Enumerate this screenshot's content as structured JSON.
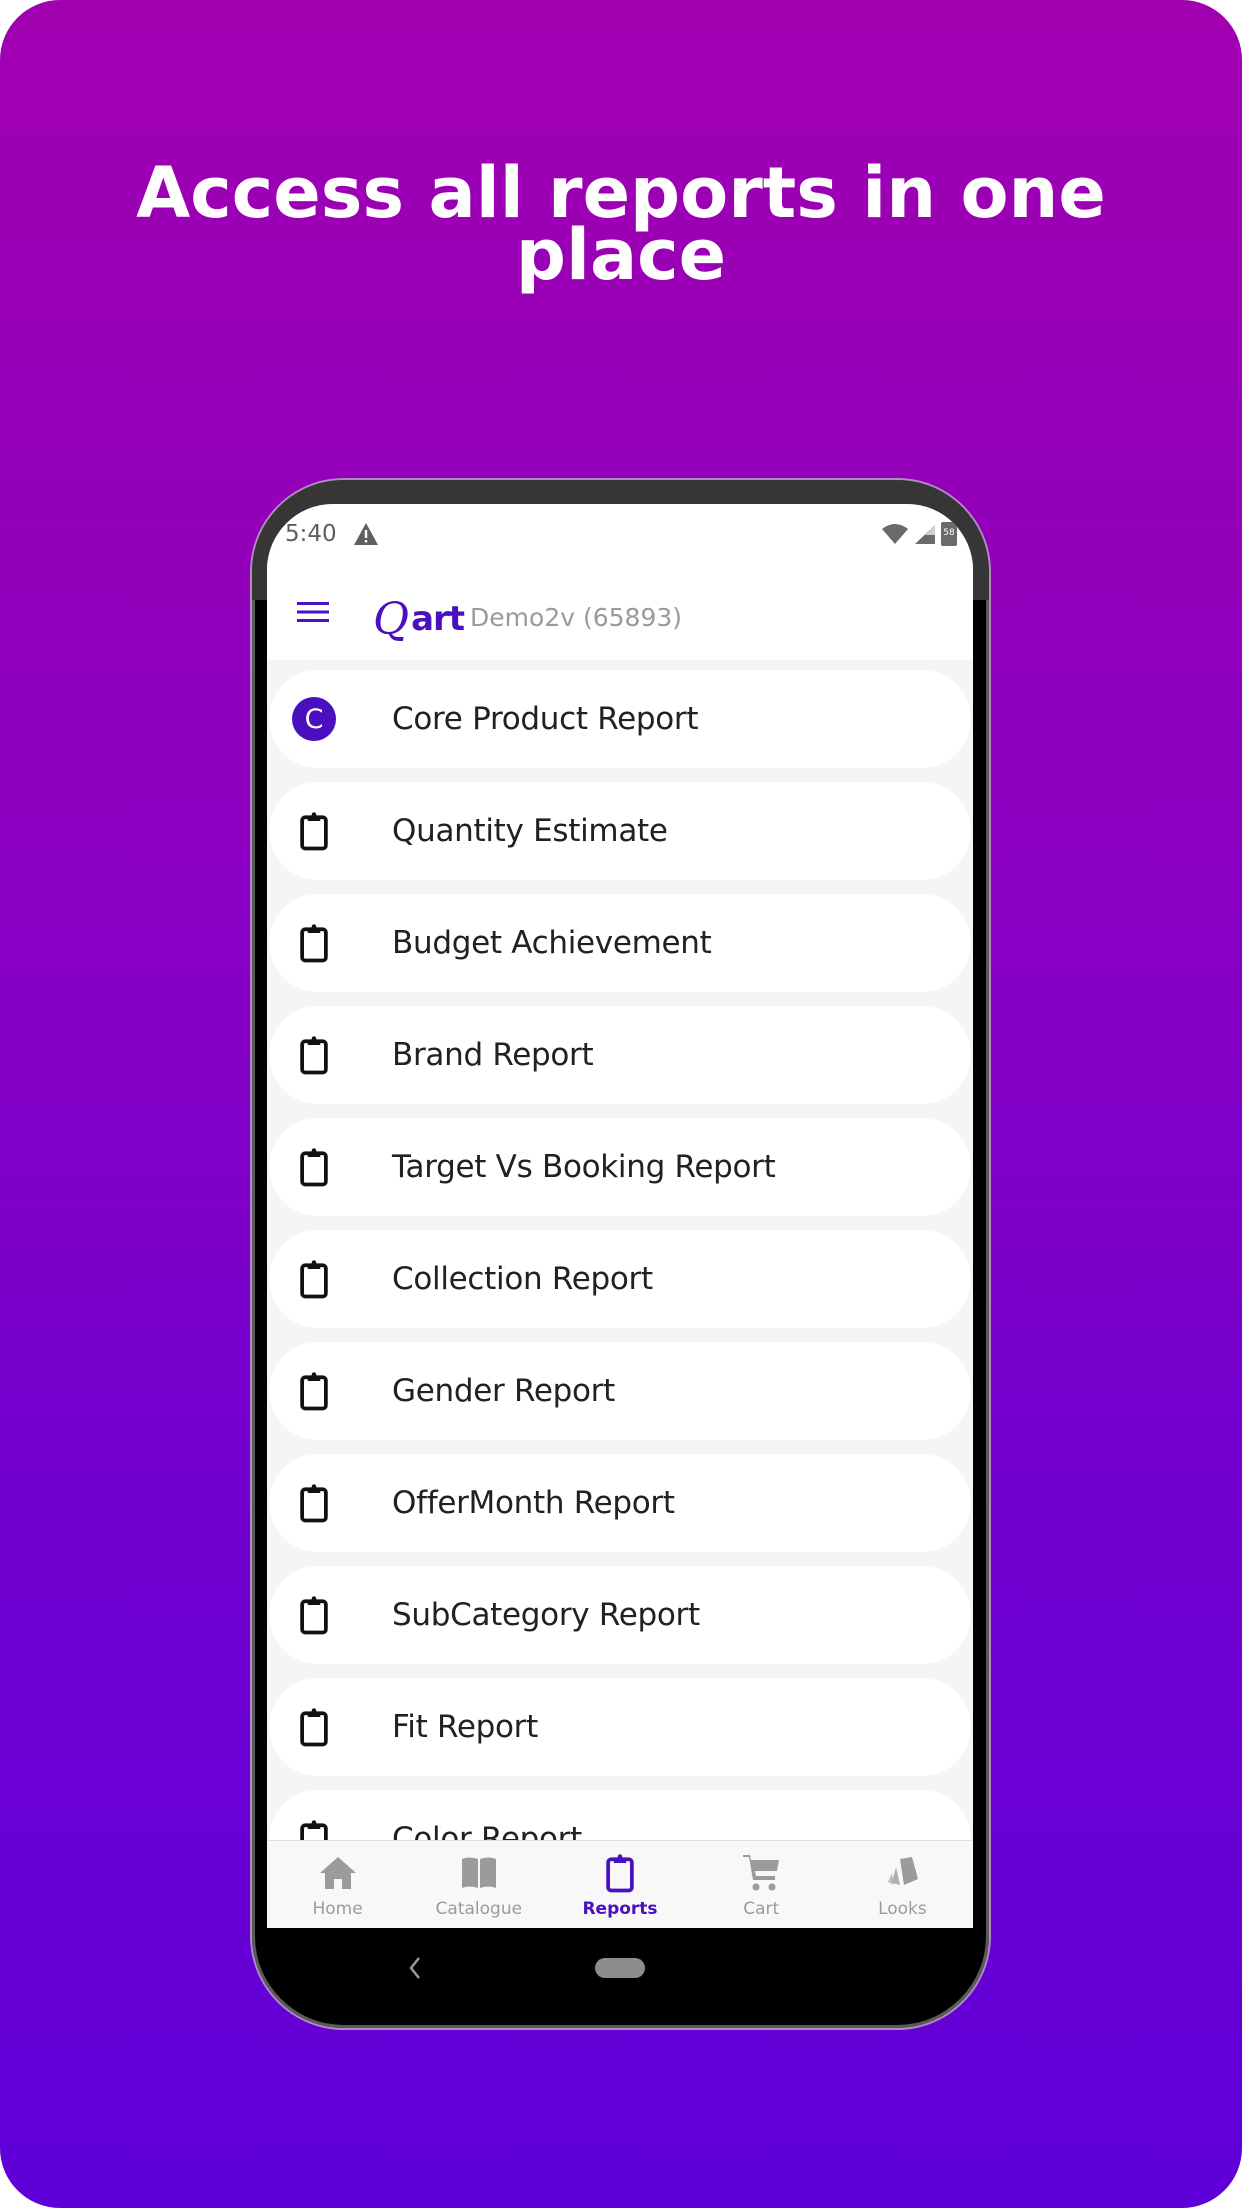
{
  "headline": {
    "line1": "Access all reports in one",
    "line2": "place"
  },
  "colors": {
    "gradient_top": "#a100b0",
    "gradient_bottom": "#5f00d9",
    "accent": "#4a10c0",
    "inactive": "#9b9b9b"
  },
  "statusbar": {
    "time": "5:40",
    "battery": "58",
    "icons": [
      "alert-icon",
      "wifi-icon",
      "signal-icon",
      "battery-icon"
    ]
  },
  "appbar": {
    "logo_mark": "Q",
    "logo_text": "art",
    "store_name": "Demo2v (65893)"
  },
  "reports": [
    {
      "label": "Core Product Report",
      "icon": "avatar-c",
      "avatar_letter": "C"
    },
    {
      "label": "Quantity Estimate",
      "icon": "clipboard-icon"
    },
    {
      "label": "Budget Achievement",
      "icon": "clipboard-icon"
    },
    {
      "label": "Brand Report",
      "icon": "clipboard-icon"
    },
    {
      "label": "Target Vs Booking Report",
      "icon": "clipboard-icon"
    },
    {
      "label": "Collection Report",
      "icon": "clipboard-icon"
    },
    {
      "label": "Gender Report",
      "icon": "clipboard-icon"
    },
    {
      "label": "OfferMonth Report",
      "icon": "clipboard-icon"
    },
    {
      "label": "SubCategory Report",
      "icon": "clipboard-icon"
    },
    {
      "label": "Fit Report",
      "icon": "clipboard-icon"
    },
    {
      "label": "Color Report",
      "icon": "clipboard-icon"
    }
  ],
  "bottom_nav": [
    {
      "label": "Home",
      "icon": "home-icon",
      "active": false
    },
    {
      "label": "Catalogue",
      "icon": "book-icon",
      "active": false
    },
    {
      "label": "Reports",
      "icon": "clipboard-icon",
      "active": true
    },
    {
      "label": "Cart",
      "icon": "cart-icon",
      "active": false
    },
    {
      "label": "Looks",
      "icon": "swatch-icon",
      "active": false
    }
  ]
}
